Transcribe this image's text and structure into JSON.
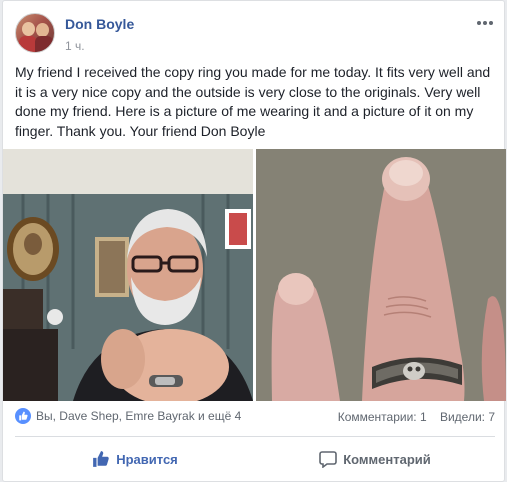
{
  "post": {
    "author": "Don Boyle",
    "time": "1 ч.",
    "text": "My friend I received the copy ring you made for me today. It fits very well and it is a very nice copy and the outside is very close to the originals. Very well done my friend. Here is a picture of me wearing it and a picture of it on my finger. Thank you. Your friend Don Boyle"
  },
  "stats": {
    "reactions_text": "Вы, Dave Shep, Emre Bayrak и ещё 4",
    "comments": "Комментарии: 1",
    "views": "Видели: 7"
  },
  "actions": {
    "like_label": "Нравится",
    "comment_label": "Комментарий"
  },
  "icons": {
    "more": "more-options-icon",
    "like": "thumbs-up-icon",
    "comment": "speech-bubble-icon"
  },
  "colors": {
    "author_link": "#365899",
    "like_active": "#4267b2",
    "reaction_badge": "#5890ff"
  }
}
